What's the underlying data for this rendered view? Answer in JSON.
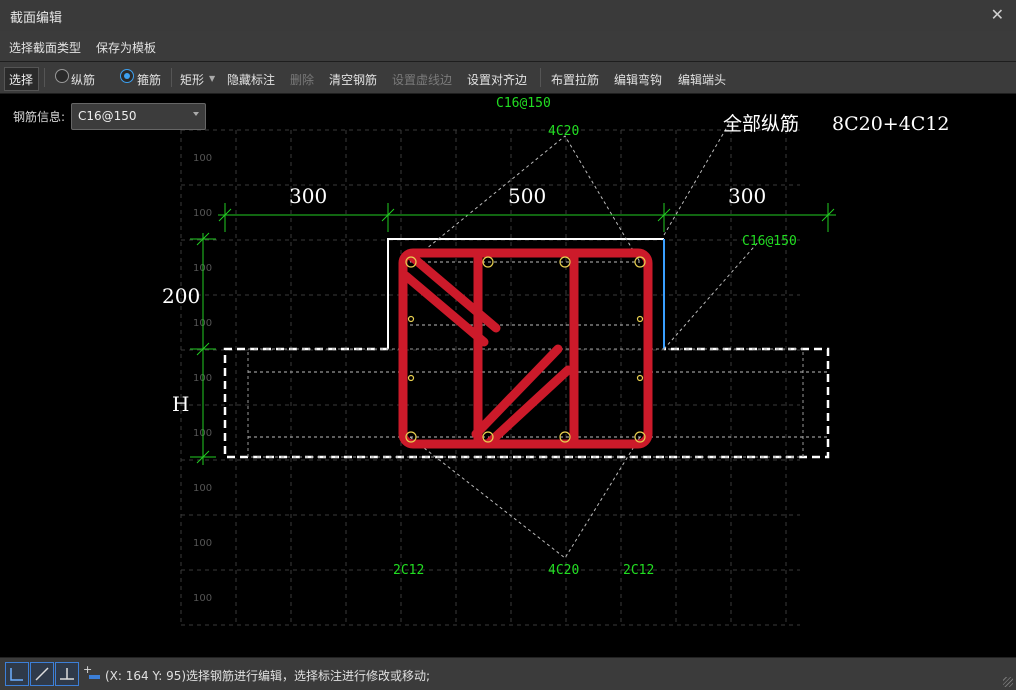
{
  "window": {
    "title": "截面编辑"
  },
  "menu": {
    "items": [
      "选择截面类型",
      "保存为模板"
    ]
  },
  "toolbar": {
    "select": "选择",
    "radio_longitudinal": "纵筋",
    "radio_stirrup": "箍筋",
    "shape": "矩形",
    "hide_annotation": "隐藏标注",
    "delete": "删除",
    "clear_rebar": "清空钢筋",
    "set_dashed_edge": "设置虚线边",
    "set_align_edge": "设置对齐边",
    "place_tie": "布置拉筋",
    "edit_hook": "编辑弯钩",
    "edit_end": "编辑端头"
  },
  "rebar_info": {
    "label": "钢筋信息:",
    "value": "C16@150"
  },
  "drawing": {
    "grid_labels": [
      "100",
      "100",
      "100",
      "100",
      "100",
      "100",
      "100",
      "100",
      "100"
    ],
    "dim_300_left": "300",
    "dim_500": "500",
    "dim_300_right": "300",
    "dim_200": "200",
    "dim_h": "H",
    "stirrup_top": "C16@150",
    "stirrup_right": "C16@150",
    "top_bars": "4C20",
    "all_long": "全部纵筋",
    "all_long_value": "8C20+4C12",
    "bottom_left": "2C12",
    "bottom_mid": "4C20",
    "bottom_right": "2C12"
  },
  "colors": {
    "rebar": "#cc1a2a",
    "dimension": "#22cc22",
    "annotation": "#22dd22",
    "edge_blue": "#3aa0ff"
  },
  "status": {
    "message": "(X: 164 Y: 95)选择钢筋进行编辑，选择标注进行修改或移动;"
  }
}
